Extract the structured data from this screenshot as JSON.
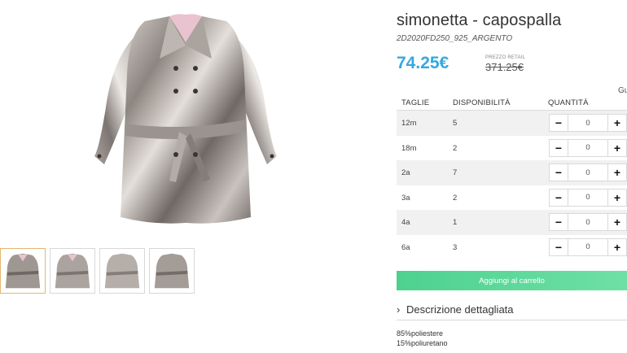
{
  "product": {
    "title": "simonetta - capospalla",
    "sku": "2D2020FD250_925_ARGENTO",
    "price": "74.25€",
    "retail_label": "PREZZO RETAIL",
    "retail_price": "371.25€",
    "guide_link": "Gu",
    "image_icon": "silver-trench-coat-image"
  },
  "thumbnails": [
    {
      "name": "coat-front"
    },
    {
      "name": "coat-front-alt"
    },
    {
      "name": "coat-back"
    },
    {
      "name": "coat-side"
    }
  ],
  "sizes_table": {
    "headers": {
      "size": "TAGLIE",
      "availability": "DISPONIBILITÀ",
      "quantity": "QUANTITÀ"
    },
    "rows": [
      {
        "size": "12m",
        "availability": "5",
        "qty": "0"
      },
      {
        "size": "18m",
        "availability": "2",
        "qty": "0"
      },
      {
        "size": "2a",
        "availability": "7",
        "qty": "0"
      },
      {
        "size": "3a",
        "availability": "2",
        "qty": "0"
      },
      {
        "size": "4a",
        "availability": "1",
        "qty": "0"
      },
      {
        "size": "6a",
        "availability": "3",
        "qty": "0"
      }
    ],
    "minus": "−",
    "plus": "+"
  },
  "cart": {
    "label": "Aggiungi al carrello"
  },
  "description": {
    "toggle_icon": "›",
    "toggle_label": "Descrizione dettagliata",
    "composition": [
      "85%poliestere",
      "15%poliuretano"
    ]
  },
  "colors": {
    "price": "#34a9df",
    "cart": "#4ed18f"
  }
}
